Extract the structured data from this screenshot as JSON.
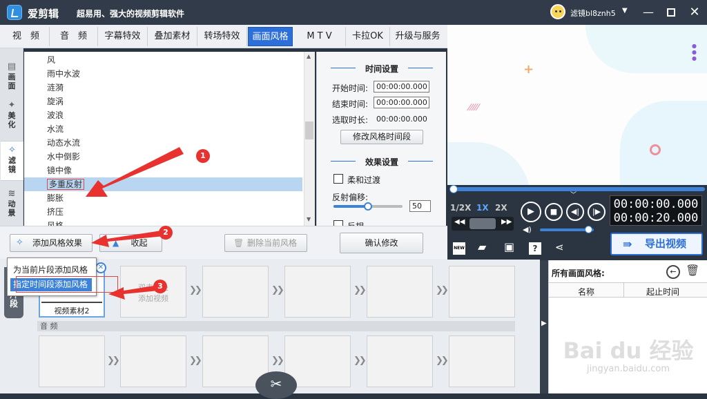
{
  "app": {
    "name": "爱剪辑",
    "slogan": "超易用、强大的视频剪辑软件",
    "username": "滤镜bl8znh5"
  },
  "tabs": [
    "视　频",
    "音　频",
    "字幕特效",
    "叠加素材",
    "转场特效",
    "画面风格",
    "M T V",
    "卡拉OK",
    "升级与服务"
  ],
  "active_tab": "画面风格",
  "side_tabs": [
    {
      "label": "画\n面"
    },
    {
      "label": "美\n化"
    },
    {
      "label": "滤\n镜"
    },
    {
      "label": "动\n景"
    }
  ],
  "effects": [
    "风",
    "雨中水波",
    "涟漪",
    "旋涡",
    "波浪",
    "水流",
    "动态水流",
    "水中倒影",
    "镜中像",
    "多重反射",
    "膨胀",
    "挤压",
    "风格"
  ],
  "selected_effect": "多重反射",
  "settings": {
    "time_title": "时间设置",
    "start_label": "开始时间:",
    "start_value": "00:00:00.000",
    "end_label": "结束时间:",
    "end_value": "00:00:00.000",
    "dur_label": "选取时长:",
    "dur_value": "00:00:00.000",
    "modify_time_btn": "修改风格时间段",
    "effect_title": "效果设置",
    "soft_label": "柔和过渡",
    "offset_label": "反射偏移:",
    "offset_value": "50",
    "reverse_label": "反相",
    "confirm_btn": "确认修改"
  },
  "toolbar": {
    "add_btn": "添加风格效果",
    "collapse_btn": "收起",
    "delete_btn": "删除当前风格"
  },
  "popup": {
    "item1": "为当前片段添加风格",
    "item2": "指定时间段添加风格"
  },
  "timeline": {
    "clip_hint": "双击此处\n添加视频",
    "clip_name": "视频素材2",
    "audio_label": "音 频",
    "side_label": "片\n段"
  },
  "player": {
    "speed_half": "1/2X",
    "speed_1": "1X",
    "speed_2": "2X",
    "time_current": "00:00:00.000",
    "time_total": "00:00:20.000",
    "export_btn": "导出视频",
    "progress": 0.0,
    "volume": 0.9,
    "offset_slider": 0.5
  },
  "right_panel": {
    "title": "所有画面风格:",
    "col_name": "名称",
    "col_time": "起止时间"
  },
  "callouts": [
    "1",
    "2",
    "3"
  ],
  "watermark": {
    "line1": "Bai du 经验",
    "line2": "jingyan.baidu.com"
  }
}
